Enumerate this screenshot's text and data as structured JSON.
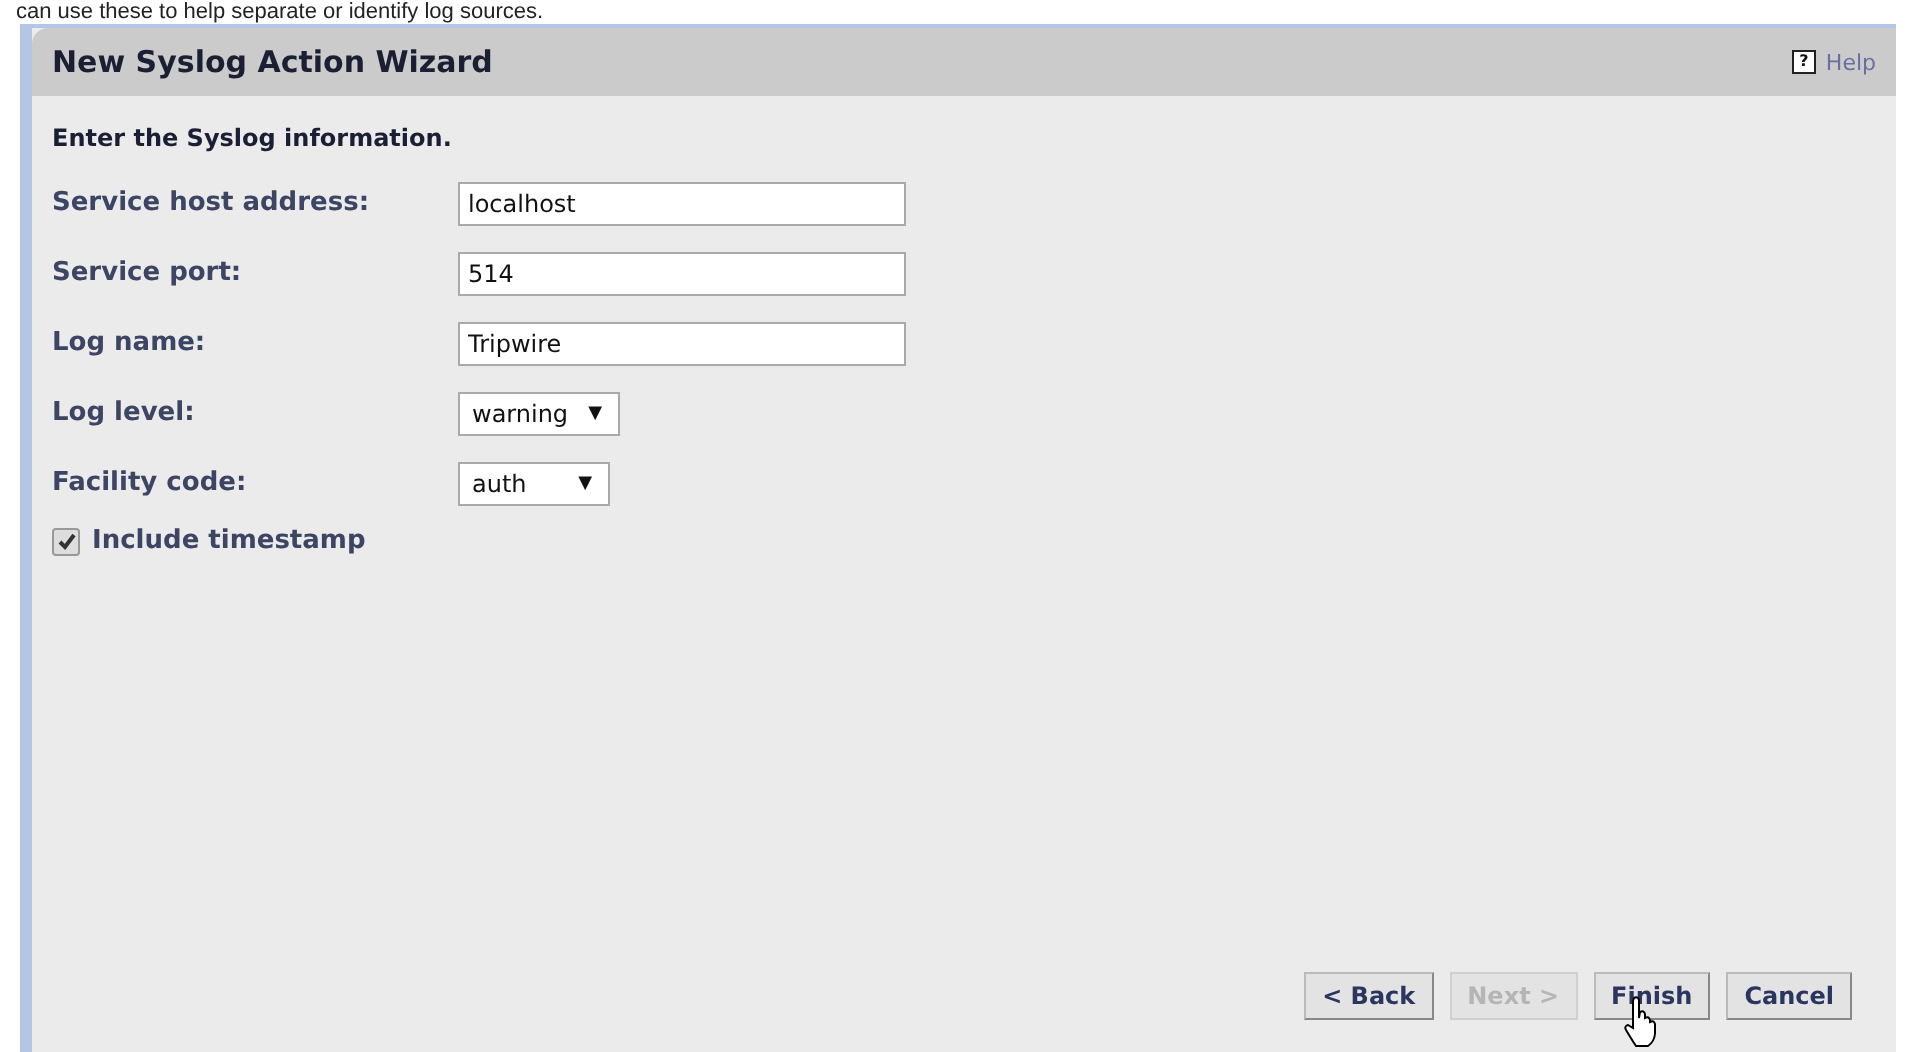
{
  "page_text": "can use these to help separate or identify log sources.",
  "window": {
    "title": "New Syslog Action Wizard",
    "help_icon": "?",
    "help": "Help"
  },
  "instruction": "Enter the Syslog information.",
  "fields": [
    {
      "kind": "text",
      "label": "Service host address:",
      "value": "localhost"
    },
    {
      "kind": "text",
      "label": "Service port:",
      "value": "514"
    },
    {
      "kind": "text",
      "label": "Log name:",
      "value": "Tripwire"
    },
    {
      "kind": "select",
      "label": "Log level:",
      "value": "warning",
      "arrow": "▼"
    },
    {
      "kind": "select",
      "label": "Facility code:",
      "value": "auth",
      "arrow": "▼"
    }
  ],
  "checkbox": {
    "label": "Include timestamp",
    "checked": true
  },
  "buttons": [
    {
      "label": "< Back",
      "disabled": false
    },
    {
      "label": "Next >",
      "disabled": true
    },
    {
      "label": "Finish",
      "disabled": false
    },
    {
      "label": "Cancel",
      "disabled": false
    }
  ]
}
